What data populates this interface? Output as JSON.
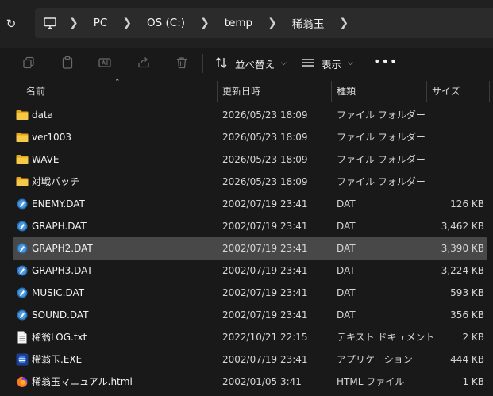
{
  "address": {
    "segments": [
      "PC",
      "OS (C:)",
      "temp",
      "稀翁玉"
    ]
  },
  "toolbar": {
    "sort_label": "並べ替え",
    "view_label": "表示"
  },
  "columns": {
    "name": "名前",
    "date": "更新日時",
    "type": "種類",
    "size": "サイズ"
  },
  "files": [
    {
      "name": "data",
      "date": "2026/05/23 18:09",
      "type": "ファイル フォルダー",
      "size": "",
      "icon": "folder-icon"
    },
    {
      "name": "ver1003",
      "date": "2026/05/23 18:09",
      "type": "ファイル フォルダー",
      "size": "",
      "icon": "folder-icon"
    },
    {
      "name": "WAVE",
      "date": "2026/05/23 18:09",
      "type": "ファイル フォルダー",
      "size": "",
      "icon": "folder-icon"
    },
    {
      "name": "対戦パッチ",
      "date": "2026/05/23 18:09",
      "type": "ファイル フォルダー",
      "size": "",
      "icon": "folder-icon"
    },
    {
      "name": "ENEMY.DAT",
      "date": "2002/07/19 23:41",
      "type": "DAT",
      "size": "126 KB",
      "icon": "dat-file-icon"
    },
    {
      "name": "GRAPH.DAT",
      "date": "2002/07/19 23:41",
      "type": "DAT",
      "size": "3,462 KB",
      "icon": "dat-file-icon"
    },
    {
      "name": "GRAPH2.DAT",
      "date": "2002/07/19 23:41",
      "type": "DAT",
      "size": "3,390 KB",
      "icon": "dat-file-icon",
      "selected": true
    },
    {
      "name": "GRAPH3.DAT",
      "date": "2002/07/19 23:41",
      "type": "DAT",
      "size": "3,224 KB",
      "icon": "dat-file-icon"
    },
    {
      "name": "MUSIC.DAT",
      "date": "2002/07/19 23:41",
      "type": "DAT",
      "size": "593 KB",
      "icon": "dat-file-icon"
    },
    {
      "name": "SOUND.DAT",
      "date": "2002/07/19 23:41",
      "type": "DAT",
      "size": "356 KB",
      "icon": "dat-file-icon"
    },
    {
      "name": "稀翁LOG.txt",
      "date": "2022/10/21 22:15",
      "type": "テキスト ドキュメント",
      "size": "2 KB",
      "icon": "text-file-icon"
    },
    {
      "name": "稀翁玉.EXE",
      "date": "2002/07/19 23:41",
      "type": "アプリケーション",
      "size": "444 KB",
      "icon": "app-icon"
    },
    {
      "name": "稀翁玉マニュアル.html",
      "date": "2002/01/05 3:41",
      "type": "HTML ファイル",
      "size": "1 KB",
      "icon": "html-file-icon"
    }
  ],
  "colors": {
    "background": "#191919",
    "selected_row": "#484848",
    "folder": "#f7c948",
    "dat_icon": "#3d8fd6"
  }
}
